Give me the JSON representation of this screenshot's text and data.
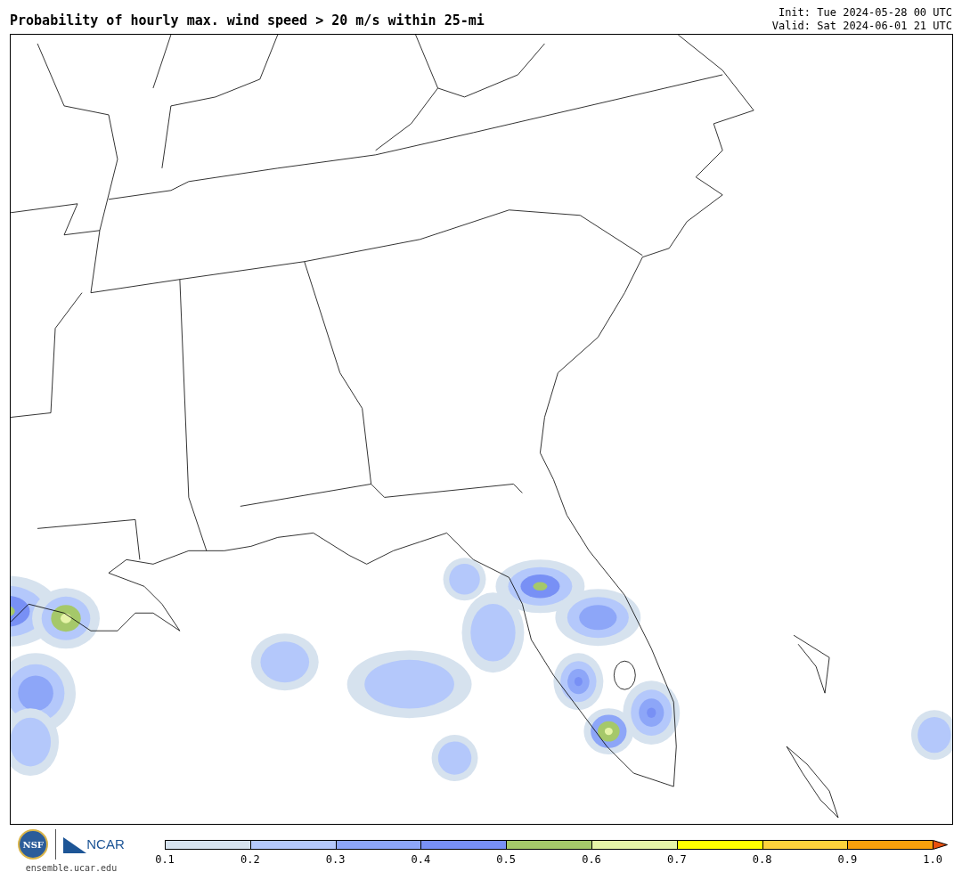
{
  "title": "Probability of hourly max. wind speed > 20 m/s within 25-mi",
  "init": "Init: Tue 2024-05-28 00 UTC",
  "valid": "Valid: Sat 2024-06-01 21 UTC",
  "logos": {
    "nsf": "NSF",
    "ncar": "NCAR",
    "url": "ensemble.ucar.edu"
  },
  "colorbar": {
    "bins": [
      {
        "color": "#d6e2ee"
      },
      {
        "color": "#b4c8fb"
      },
      {
        "color": "#8da6f8"
      },
      {
        "color": "#7890f5"
      },
      {
        "color": "#a5c86a"
      },
      {
        "color": "#e6f4a8"
      },
      {
        "color": "#ffff00"
      },
      {
        "color": "#fcd23c"
      },
      {
        "color": "#f9a00c"
      }
    ],
    "extension": {
      "color": "#e8500e"
    },
    "ticks": [
      "0.1",
      "0.2",
      "0.3",
      "0.4",
      "0.5",
      "0.6",
      "0.7",
      "0.8",
      "0.9",
      "1.0"
    ]
  }
}
